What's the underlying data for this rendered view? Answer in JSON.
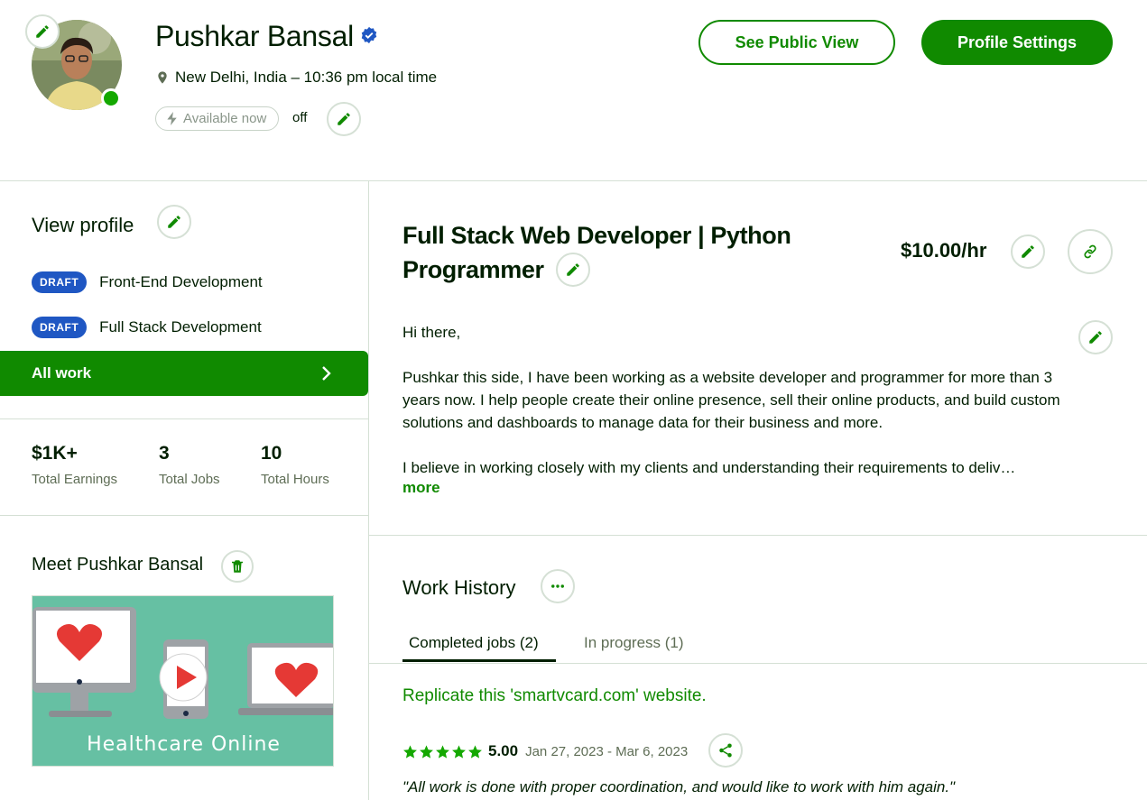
{
  "header": {
    "name": "Pushkar Bansal",
    "location": "New Delhi, India – 10:36 pm local time",
    "availability_label": "Available now",
    "availability_state": "off",
    "public_view_button": "See Public View",
    "settings_button": "Profile Settings"
  },
  "sidebar": {
    "view_profile": "View profile",
    "specialized_profiles": [
      {
        "badge": "DRAFT",
        "label": "Front-End Development"
      },
      {
        "badge": "DRAFT",
        "label": "Full Stack Development"
      }
    ],
    "all_work": "All work",
    "stats": [
      {
        "value": "$1K+",
        "label": "Total Earnings"
      },
      {
        "value": "3",
        "label": "Total Jobs"
      },
      {
        "value": "10",
        "label": "Total Hours"
      }
    ],
    "meet_title": "Meet Pushkar Bansal",
    "video_caption": "Healthcare Online"
  },
  "main": {
    "headline": "Full Stack Web Developer | Python Programmer",
    "rate": "$10.00/hr",
    "overview": [
      "Hi there,",
      "Pushkar this side, I have been working as a website developer and programmer for more than 3 years now. I help people create their online presence, sell their online products, and build custom solutions and dashboards to manage data for their business and more.",
      "I believe in working closely with my clients and understanding their requirements to deliv…"
    ],
    "more_link": "more",
    "work_history": {
      "title": "Work History",
      "tabs": [
        {
          "label": "Completed jobs (2)",
          "active": true
        },
        {
          "label": "In progress (1)",
          "active": false
        }
      ],
      "jobs": [
        {
          "title": "Replicate this 'smartvcard.com' website.",
          "rating": "5.00",
          "stars": 5,
          "dates": "Jan 27, 2023 - Mar 6, 2023",
          "review": "\"All work is done with proper coordination, and would like to work with him again.\""
        }
      ]
    }
  },
  "colors": {
    "brand_green": "#108a00",
    "draft_blue": "#1f57c3",
    "online_green": "#14a800",
    "video_bg": "#66c0a3"
  }
}
